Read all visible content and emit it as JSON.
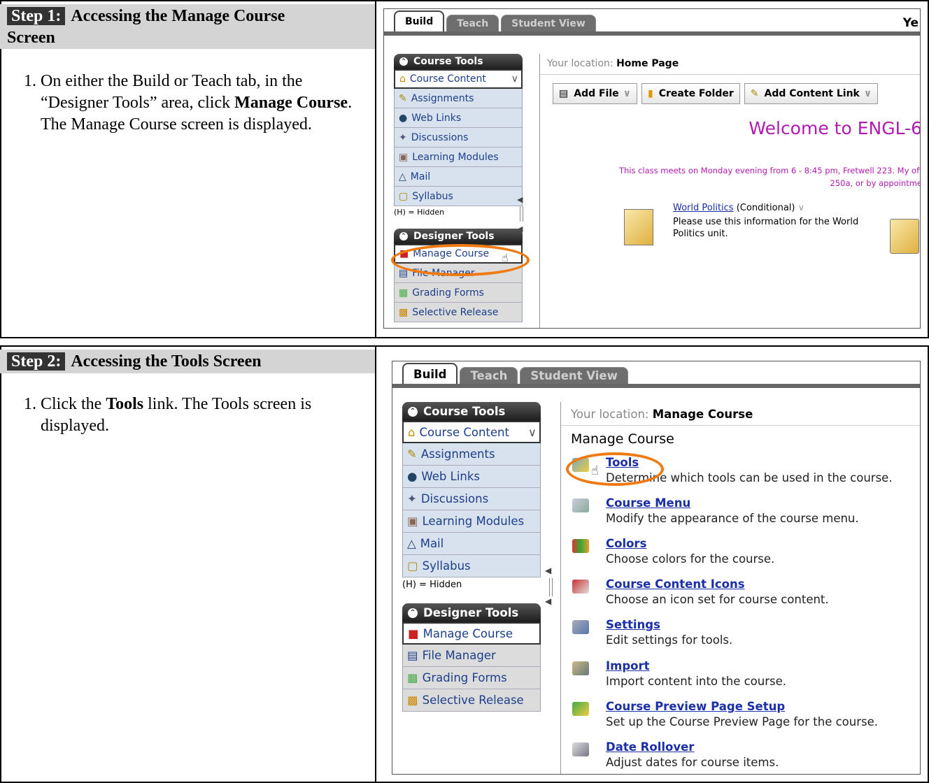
{
  "step1": {
    "label": "Step 1:",
    "title_line1": "Accessing the Manage Course",
    "title_line2": "Screen",
    "instruction_prefix": "On either the Build or Teach tab, in the “Designer Tools” area, click ",
    "instruction_bold1": "Manage Course",
    "instruction_suffix": ". The Manage Course screen is displayed.",
    "screenshot": {
      "tabs": [
        "Build",
        "Teach",
        "Student View"
      ],
      "truncated_header": "Ye",
      "course_tools_title": "Course Tools",
      "course_items": [
        "Course Content",
        "Assignments",
        "Web Links",
        "Discussions",
        "Learning Modules",
        "Mail",
        "Syllabus"
      ],
      "hidden_note": "(H) = Hidden",
      "designer_tools_title": "Designer Tools",
      "designer_items": [
        "Manage Course",
        "File Manager",
        "Grading Forms",
        "Selective Release"
      ],
      "location_label": "Your location:",
      "location_value": "Home Page",
      "buttons": [
        "Add File",
        "Create Folder",
        "Add Content Link"
      ],
      "welcome": "Welcome to ENGL-6",
      "meets_line1": "This class meets on Monday evening from 6 - 8:45 pm, Fretwell 223. My off",
      "meets_line2": "250a, or by appointme",
      "item_link": "World Politics",
      "item_tag": "(Conditional)",
      "item_desc": "Please use this information for the World Politics unit."
    }
  },
  "step2": {
    "label": "Step 2:",
    "title": "Accessing the Tools Screen",
    "instruction_prefix": "Click the ",
    "instruction_bold": "Tools",
    "instruction_suffix": " link. The Tools screen is displayed.",
    "screenshot": {
      "tabs": [
        "Build",
        "Teach",
        "Student View"
      ],
      "course_tools_title": "Course Tools",
      "course_items": [
        "Course Content",
        "Assignments",
        "Web Links",
        "Discussions",
        "Learning Modules",
        "Mail",
        "Syllabus"
      ],
      "hidden_note": "(H) = Hidden",
      "designer_tools_title": "Designer Tools",
      "designer_items": [
        "Manage Course",
        "File Manager",
        "Grading Forms",
        "Selective Release"
      ],
      "location_label": "Your location:",
      "location_value": "Manage Course",
      "heading": "Manage Course",
      "items": [
        {
          "link": "Tools",
          "desc": "Determine which tools can be used in the course."
        },
        {
          "link": "Course Menu",
          "desc": "Modify the appearance of the course menu."
        },
        {
          "link": "Colors",
          "desc": "Choose colors for the course."
        },
        {
          "link": "Course Content Icons",
          "desc": "Choose an icon set for course content."
        },
        {
          "link": "Settings",
          "desc": "Edit settings for tools."
        },
        {
          "link": "Import",
          "desc": "Import content into the course."
        },
        {
          "link": "Course Preview Page Setup",
          "desc": "Set up the Course Preview Page for the course."
        },
        {
          "link": "Date Rollover",
          "desc": "Adjust dates for course items."
        }
      ]
    }
  },
  "colors": {
    "callout": "#f07a12",
    "link": "#1a2fa8",
    "welcome": "#b01ab0",
    "nav_bg": "#d8e2ee"
  }
}
